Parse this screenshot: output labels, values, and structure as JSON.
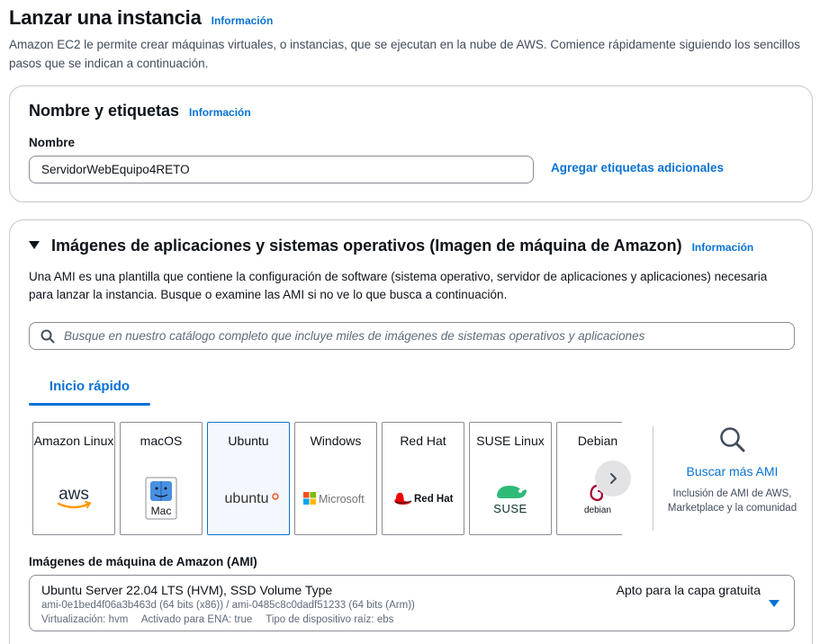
{
  "page": {
    "title": "Lanzar una instancia",
    "info_link": "Información",
    "intro": "Amazon EC2 le permite crear máquinas virtuales, o instancias, que se ejecutan en la nube de AWS. Comience rápidamente siguiendo los sencillos pasos que se indican a continuación."
  },
  "name_tags": {
    "title": "Nombre y etiquetas",
    "info_link": "Información",
    "name_label": "Nombre",
    "name_value": "ServidorWebEquipo4RETO",
    "add_tags_link": "Agregar etiquetas adicionales"
  },
  "ami_section": {
    "title": "Imágenes de aplicaciones y sistemas operativos (Imagen de máquina de Amazon)",
    "info_link": "Información",
    "description": "Una AMI es una plantilla que contiene la configuración de software (sistema operativo, servidor de aplicaciones y aplicaciones) necesaria para lanzar la instancia. Busque o examine las AMI si no ve lo que busca a continuación.",
    "search_placeholder": "Busque en nuestro catálogo completo que incluye miles de imágenes de sistemas operativos y aplicaciones",
    "search_icon": "search-icon",
    "tab_label": "Inicio rápido",
    "tiles": [
      {
        "name": "Amazon Linux",
        "logo": "aws",
        "selected": false
      },
      {
        "name": "macOS",
        "logo": "Mac",
        "selected": false
      },
      {
        "name": "Ubuntu",
        "logo": "ubuntu",
        "selected": true
      },
      {
        "name": "Windows",
        "logo": "Microsoft",
        "selected": false
      },
      {
        "name": "Red Hat",
        "logo": "Red Hat",
        "selected": false
      },
      {
        "name": "SUSE Linux",
        "logo": "SUSE",
        "selected": false
      },
      {
        "name": "Debian",
        "logo": "debian",
        "selected": false
      }
    ],
    "more_ami": {
      "link": "Buscar más AMI",
      "description": "Inclusión de AMI de AWS, Marketplace y la comunidad"
    },
    "ami_label": "Imágenes de máquina de Amazon (AMI)",
    "selected_ami": {
      "title": "Ubuntu Server 22.04 LTS (HVM), SSD Volume Type",
      "badge": "Apto para la capa gratuita",
      "ids": "ami-0e1bed4f06a3b463d (64 bits (x86)) / ami-0485c8c0dadf51233 (64 bits (Arm))",
      "virtualization": "Virtualización: hvm",
      "ena": "Activado para ENA: true",
      "root_device": "Tipo de dispositivo raíz: ebs"
    }
  },
  "colors": {
    "link": "#0972d3",
    "border": "#8c8c94",
    "text": "#0f141a",
    "aws_orange": "#ff9900",
    "ubuntu_orange": "#e95420",
    "redhat_red": "#ee0000",
    "suse_green": "#30ba78",
    "debian_red": "#a80030"
  }
}
